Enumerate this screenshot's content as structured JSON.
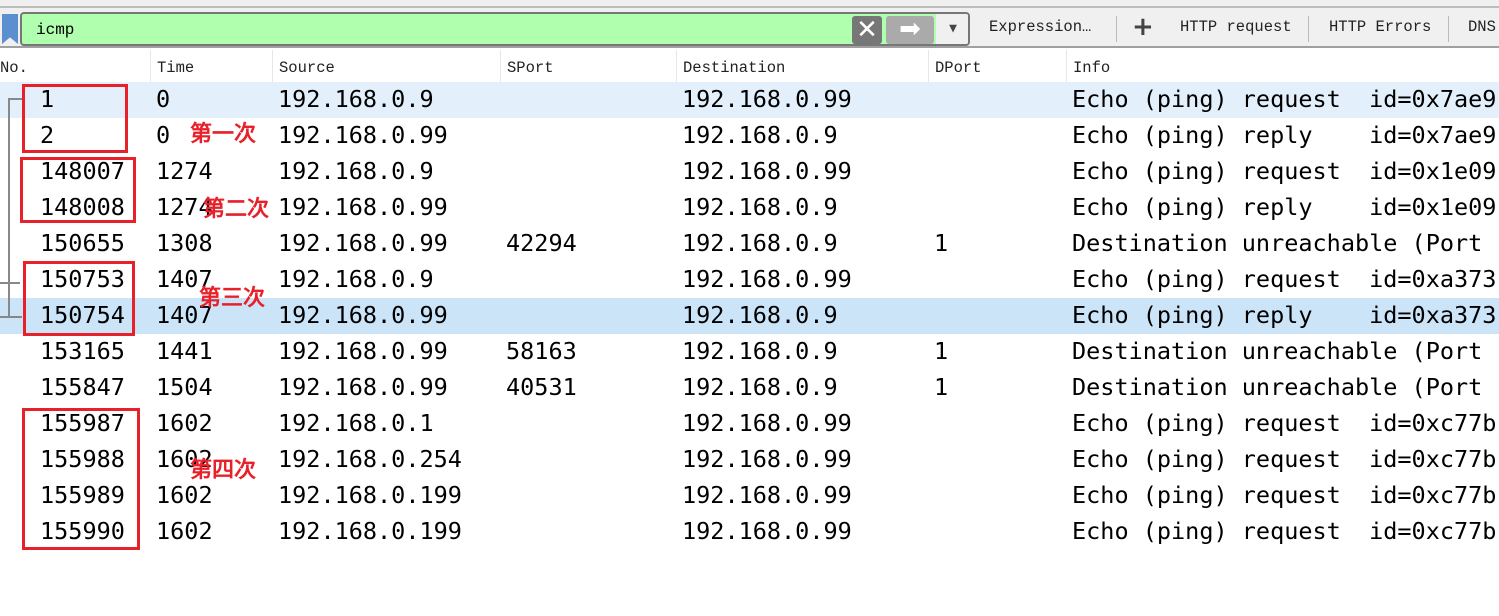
{
  "toolbar": {
    "filter_value": "icmp",
    "bookmark_icon": "bookmark-icon",
    "clear_icon": "close-icon",
    "apply_icon": "arrow-right-icon",
    "dropdown_icon": "chevron-down-icon",
    "expression_label": "Expression…",
    "add_icon": "plus-icon",
    "buttons": [
      "HTTP request",
      "HTTP Errors",
      "DNS"
    ],
    "filter_color": "#afffaf"
  },
  "columns": [
    "No.",
    "Time",
    "Source",
    "SPort",
    "Destination",
    "DPort",
    "Info"
  ],
  "rows": [
    {
      "no": "1",
      "time": "0",
      "src": "192.168.0.9",
      "sport": "",
      "dst": "192.168.0.99",
      "dport": "",
      "info": "Echo (ping) request  id=0x7ae9"
    },
    {
      "no": "2",
      "time": "0",
      "src": "192.168.0.99",
      "sport": "",
      "dst": "192.168.0.9",
      "dport": "",
      "info": "Echo (ping) reply    id=0x7ae9"
    },
    {
      "no": "148007",
      "time": "1274",
      "src": "192.168.0.9",
      "sport": "",
      "dst": "192.168.0.99",
      "dport": "",
      "info": "Echo (ping) request  id=0x1e09"
    },
    {
      "no": "148008",
      "time": "1274",
      "src": "192.168.0.99",
      "sport": "",
      "dst": "192.168.0.9",
      "dport": "",
      "info": "Echo (ping) reply    id=0x1e09"
    },
    {
      "no": "150655",
      "time": "1308",
      "src": "192.168.0.99",
      "sport": "42294",
      "dst": "192.168.0.9",
      "dport": "1",
      "info": "Destination unreachable (Port"
    },
    {
      "no": "150753",
      "time": "1407",
      "src": "192.168.0.9",
      "sport": "",
      "dst": "192.168.0.99",
      "dport": "",
      "info": "Echo (ping) request  id=0xa373"
    },
    {
      "no": "150754",
      "time": "1407",
      "src": "192.168.0.99",
      "sport": "",
      "dst": "192.168.0.9",
      "dport": "",
      "info": "Echo (ping) reply    id=0xa373"
    },
    {
      "no": "153165",
      "time": "1441",
      "src": "192.168.0.99",
      "sport": "58163",
      "dst": "192.168.0.9",
      "dport": "1",
      "info": "Destination unreachable (Port"
    },
    {
      "no": "155847",
      "time": "1504",
      "src": "192.168.0.99",
      "sport": "40531",
      "dst": "192.168.0.9",
      "dport": "1",
      "info": "Destination unreachable (Port"
    },
    {
      "no": "155987",
      "time": "1602",
      "src": "192.168.0.1",
      "sport": "",
      "dst": "192.168.0.99",
      "dport": "",
      "info": "Echo (ping) request  id=0xc77b"
    },
    {
      "no": "155988",
      "time": "1602",
      "src": "192.168.0.254",
      "sport": "",
      "dst": "192.168.0.99",
      "dport": "",
      "info": "Echo (ping) request  id=0xc77b"
    },
    {
      "no": "155989",
      "time": "1602",
      "src": "192.168.0.199",
      "sport": "",
      "dst": "192.168.0.99",
      "dport": "",
      "info": "Echo (ping) request  id=0xc77b"
    },
    {
      "no": "155990",
      "time": "1602",
      "src": "192.168.0.199",
      "sport": "",
      "dst": "192.168.0.99",
      "dport": "",
      "info": "Echo (ping) request  id=0xc77b"
    }
  ],
  "annotations": [
    "第一次",
    "第二次",
    "第三次",
    "第四次"
  ],
  "colors": {
    "annotation": "#e8202a",
    "row_highlight": "#e3f0fb",
    "row_selected": "#cce4f7"
  }
}
